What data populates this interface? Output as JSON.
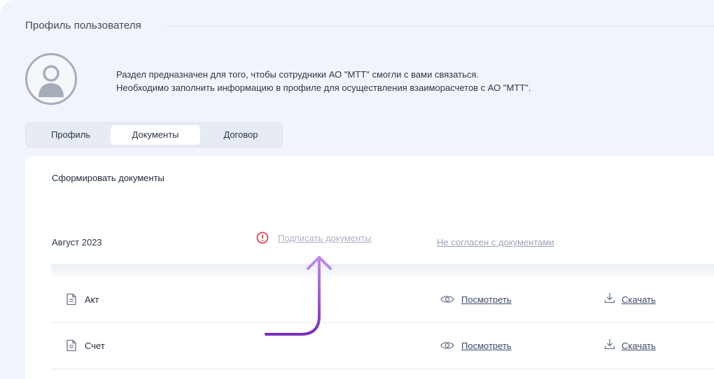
{
  "page": {
    "title": "Профиль пользователя"
  },
  "intro": {
    "line1": "Раздел предназначен для того, чтобы сотрудники АО \"МТТ\" смогли с вами связаться.",
    "line2": "Необходимо заполнить информацию в профиле для осуществления взаиморасчетов с АО \"МТТ\"."
  },
  "tabs": [
    {
      "label": "Профиль",
      "active": false
    },
    {
      "label": "Документы",
      "active": true
    },
    {
      "label": "Договор",
      "active": false
    }
  ],
  "documents": {
    "title": "Сформировать документы",
    "period": "Август 2023",
    "sign_label": "Подписать документы",
    "reject_label": "Не согласен с документами",
    "rows": [
      {
        "name": "Акт",
        "view_label": "Посмотреть",
        "download_label": "Скачать"
      },
      {
        "name": "Счет",
        "view_label": "Посмотреть",
        "download_label": "Скачать"
      }
    ]
  },
  "colors": {
    "background": "#f1f4fa",
    "panel": "#ffffff",
    "alert": "#e0464e",
    "arrow": "#8b3fc8",
    "link": "#3a4a68",
    "muted_link": "#aab2c0"
  },
  "icons": [
    "user-avatar-icon",
    "alert-circle-icon",
    "document-icon",
    "eye-icon",
    "download-icon",
    "pointer-arrow-icon"
  ]
}
